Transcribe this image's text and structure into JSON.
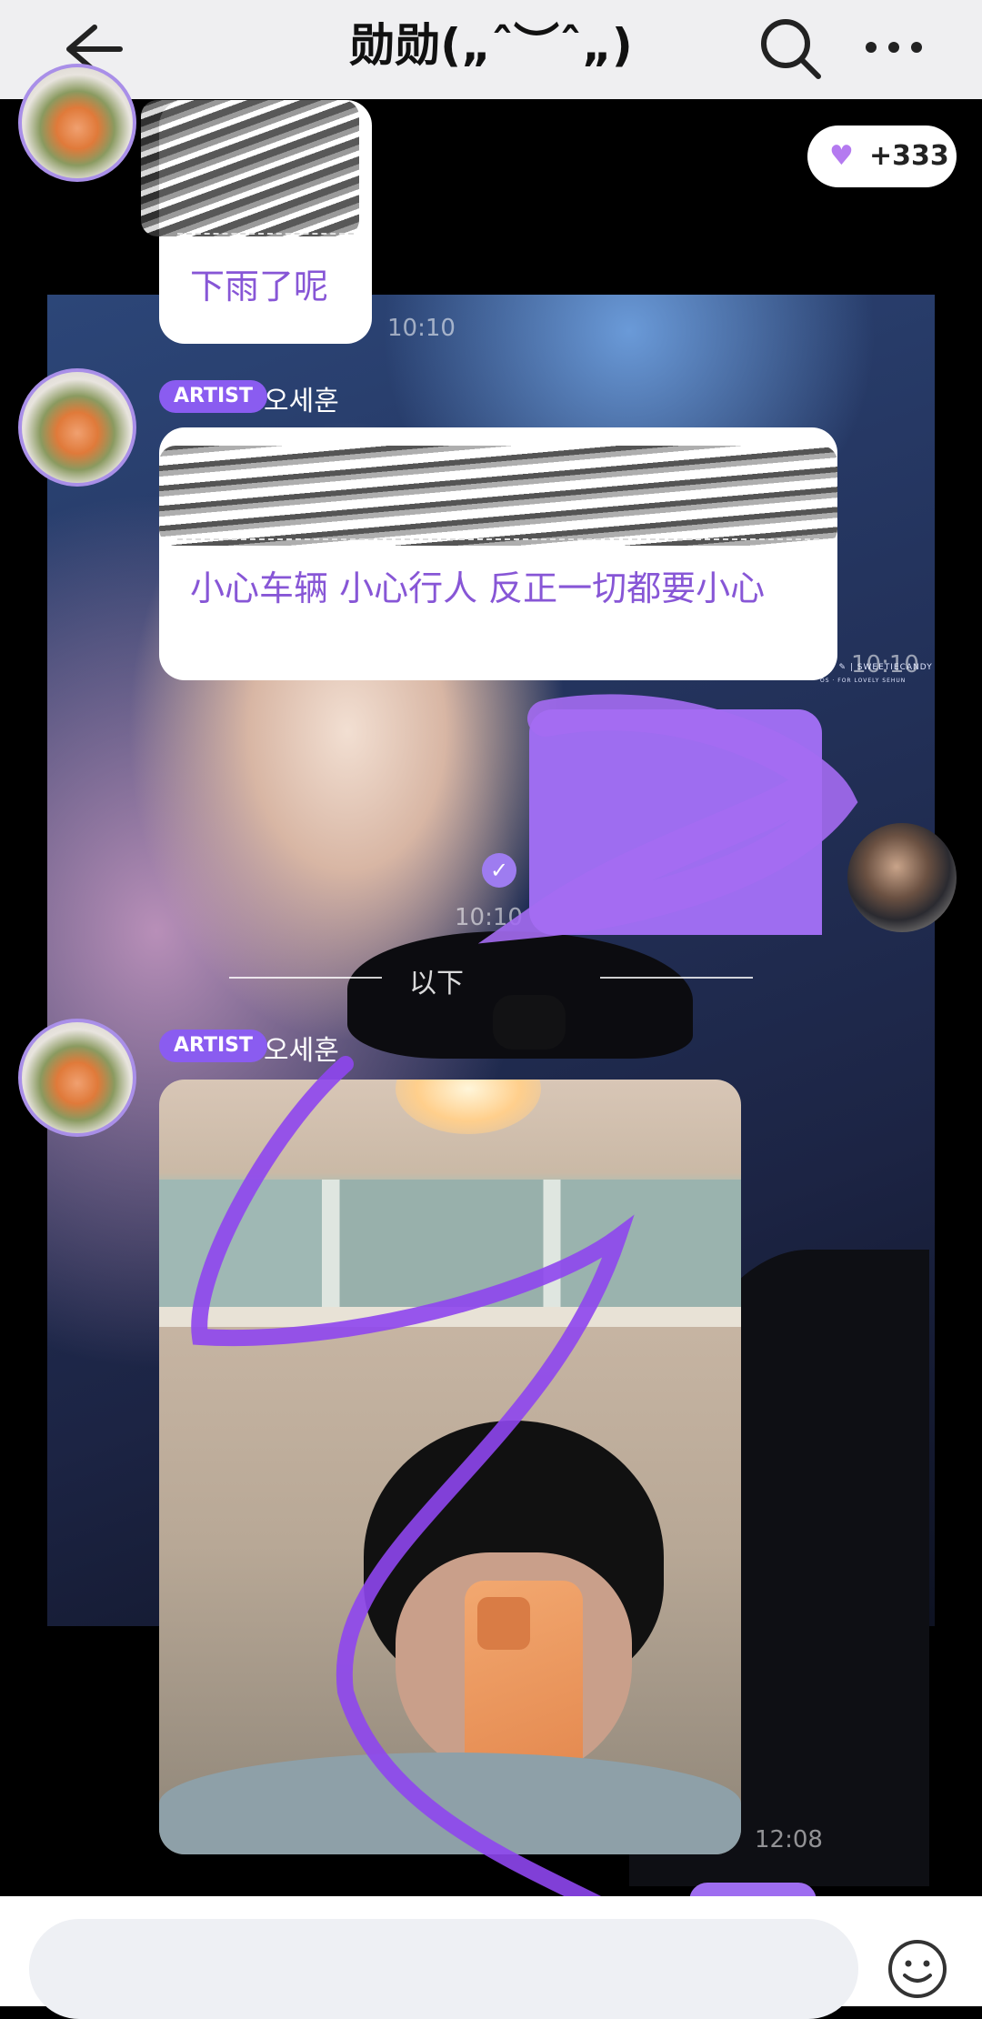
{
  "header": {
    "title": "勋勋(„ˆ︶ˆ„)"
  },
  "reactions": {
    "count": "+333",
    "icon": "heart-icon"
  },
  "watermark": {
    "line1": "SW ✎ | SWEETIECANDY",
    "line2": "OS · FOR LOVELY SEHUN"
  },
  "messages": [
    {
      "text": "下雨了呢",
      "time": "10:10"
    },
    {
      "badge": "ARTIST",
      "sender": "오세훈",
      "text": "小心车辆 小心行人 反正一切都要小心",
      "time": "10:10"
    },
    {
      "time": "10:10"
    },
    {
      "badge": "ARTIST",
      "sender": "오세훈",
      "time": "12:08"
    }
  ],
  "divider": {
    "text": "以下"
  },
  "input": {
    "placeholder": ""
  },
  "colors": {
    "accent": "#8a5cf0",
    "message_text": "#8756d6",
    "header_bg": "#efeff1"
  }
}
